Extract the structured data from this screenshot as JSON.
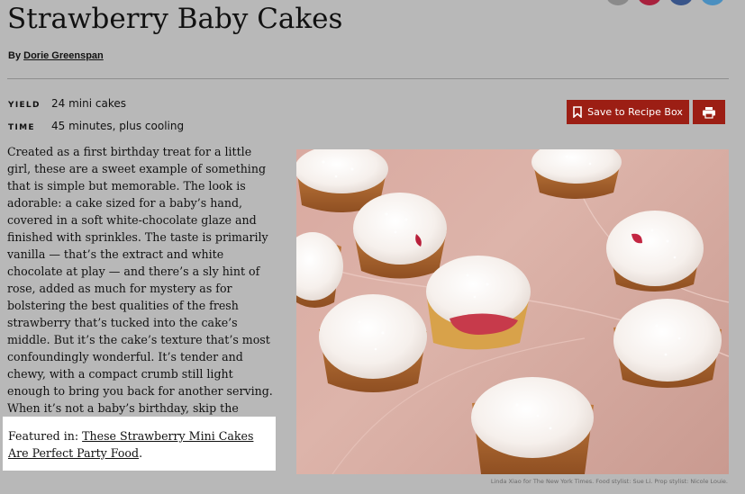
{
  "recipe": {
    "title": "Strawberry Baby Cakes",
    "byline_prefix": "By",
    "author": "Dorie Greenspan",
    "yield_label": "YIELD",
    "yield_value": "24 mini cakes",
    "time_label": "TIME",
    "time_value": "45 minutes, plus cooling",
    "description": "Created as a first birthday treat for a little girl, these are a sweet example of something that is simple but memorable. The look is adorable: a cake sized for a baby’s hand, covered in a soft white-chocolate glaze and finished with sprinkles. The taste is primarily vanilla — that’s the extract and white chocolate at play — and there’s a sly hint of rose, added as much for mystery as for bolstering the best qualities of the fresh strawberry that’s tucked into the cake’s middle. But it’s the cake’s texture that’s most confoundingly wonderful. It’s tender and chewy, with a compact crumb still light enough to bring you back for another serving. When it’s not a baby’s birthday, skip the candles and have the cakes with espresso — or even Champagne.",
    "featured_prefix": "Featured in:",
    "featured_link": "These Strawberry Mini Cakes Are Perfect Party Food",
    "featured_suffix": ".",
    "photo_credit": "Linda Xiao for The New York Times. Food stylist: Sue Li. Prop stylist: Nicole Louie."
  },
  "toolbar": {
    "save_label": "Save to Recipe Box",
    "save_icon": "bookmark-icon",
    "print_icon": "printer-icon"
  },
  "share": {
    "icons": [
      "email-icon",
      "pinterest-icon",
      "facebook-icon",
      "twitter-icon"
    ],
    "colors": [
      "#8a8a8a",
      "#a8213d",
      "#39558a",
      "#4a8fc0"
    ]
  },
  "colors": {
    "accent": "#9c1e14",
    "overlay": "#b8b8b8",
    "highlight": "#ffffff"
  }
}
